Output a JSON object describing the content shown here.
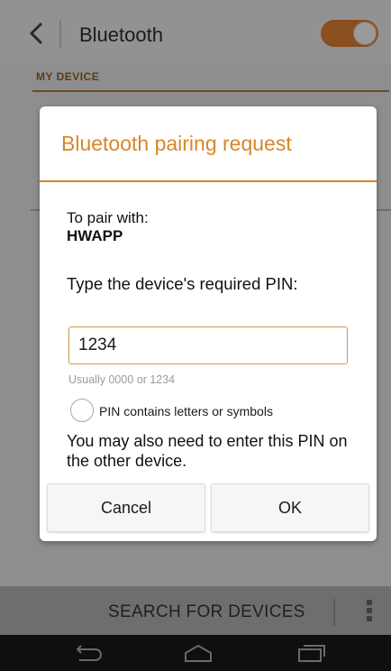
{
  "header": {
    "title": "Bluetooth",
    "back_icon": "chevron-left-icon",
    "toggle_state": "on"
  },
  "section": {
    "header": "MY DEVICE"
  },
  "dialog": {
    "title": "Bluetooth pairing request",
    "pair_with_label": "To pair with:",
    "device_name": "HWAPP",
    "pin_prompt": "Type the device's required PIN:",
    "pin_value": "1234",
    "pin_hint": "Usually 0000 or 1234",
    "alphanumeric_option": "PIN contains letters or symbols",
    "alphanumeric_checked": false,
    "notice": "You may also need to enter this PIN on the other device.",
    "cancel_label": "Cancel",
    "ok_label": "OK"
  },
  "bottom_bar": {
    "search_label": "SEARCH FOR DEVICES",
    "overflow_icon": "overflow-menu-icon"
  },
  "nav_bar": {
    "icons": [
      "back-icon",
      "home-icon",
      "recent-apps-icon"
    ]
  },
  "colors": {
    "accent": "#d8862b",
    "input_border": "#d39550"
  }
}
